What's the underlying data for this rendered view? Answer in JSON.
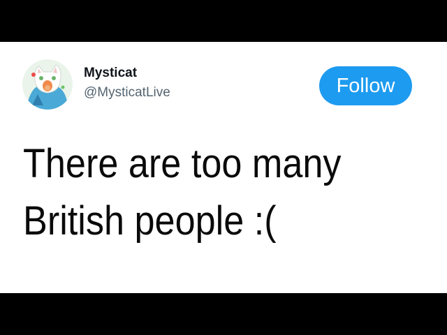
{
  "user": {
    "display_name": "Mysticat",
    "handle": "@MysticatLive"
  },
  "actions": {
    "follow_label": "Follow"
  },
  "tweet": {
    "lines": [
      "There are too many",
      "British people :("
    ]
  },
  "colors": {
    "follow_button": "#1d9bf0",
    "handle_text": "#536471",
    "name_text": "#0f1419",
    "card_background": "#ffffff",
    "letterbox": "#000000"
  }
}
